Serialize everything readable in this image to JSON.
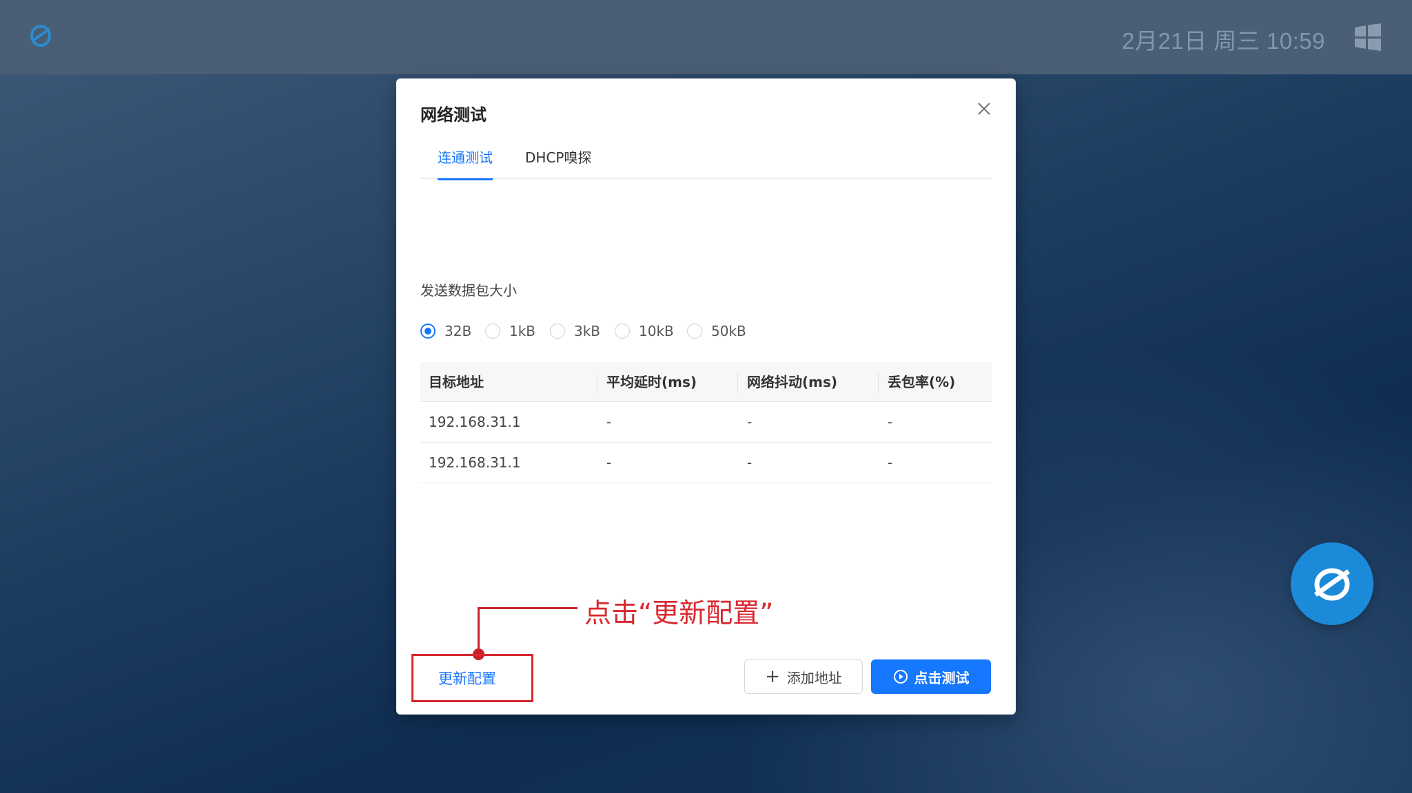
{
  "topbar": {
    "clock": "2月21日 周三 10:59",
    "logo_icon": "app-logo-icon",
    "start_icon": "windows-icon"
  },
  "dialog": {
    "title": "网络测试",
    "close_icon": "close-icon",
    "tabs": [
      {
        "label": "连通测试",
        "active": true
      },
      {
        "label": "DHCP嗅探",
        "active": false
      }
    ],
    "packet_size_label": "发送数据包大小",
    "packet_sizes": [
      {
        "label": "32B",
        "checked": true
      },
      {
        "label": "1kB",
        "checked": false
      },
      {
        "label": "3kB",
        "checked": false
      },
      {
        "label": "10kB",
        "checked": false
      },
      {
        "label": "50kB",
        "checked": false
      }
    ],
    "table": {
      "headers": [
        "目标地址",
        "平均延时(ms)",
        "网络抖动(ms)",
        "丢包率(%)"
      ],
      "rows": [
        [
          "192.168.31.1",
          "-",
          "-",
          "-"
        ],
        [
          "192.168.31.1",
          "-",
          "-",
          "-"
        ]
      ]
    },
    "buttons": {
      "update_config": "更新配置",
      "add_address": "添加地址",
      "start_test": "点击测试"
    }
  },
  "annotation": {
    "text": "点击“更新配置”",
    "color": "#d8282f"
  },
  "colors": {
    "accent": "#1677ff",
    "assistant": "#1b8ad9"
  }
}
